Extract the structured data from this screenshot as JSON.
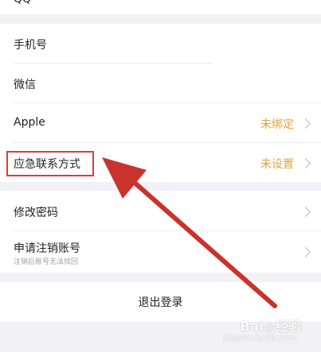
{
  "top_partial_label": "QQ",
  "account_rows": [
    {
      "label": "手机号"
    },
    {
      "label": "微信"
    },
    {
      "label": "Apple",
      "status": "未绑定"
    },
    {
      "label": "应急联系方式",
      "status": "未设置"
    }
  ],
  "security_rows": [
    {
      "label": "修改密码"
    },
    {
      "label": "申请注销账号",
      "sublabel": "注销后账号无法找回"
    }
  ],
  "logout_label": "退出登录",
  "watermark": {
    "brand": "Bai◎经验",
    "url": "jingyan.baidu.com"
  },
  "colors": {
    "status": "#e8a03e",
    "highlight": "#e03b36",
    "arrow": "#c8332b",
    "background": "#f2f2f6"
  }
}
